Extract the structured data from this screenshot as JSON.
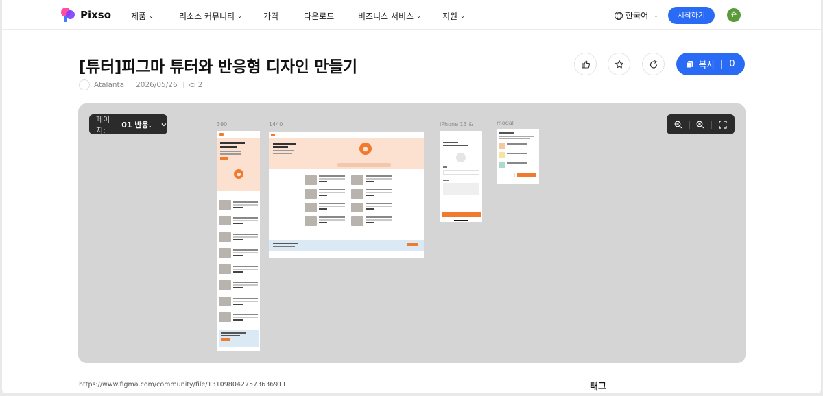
{
  "header": {
    "brand": "Pixso",
    "nav": [
      {
        "label": "제품",
        "has_caret": true
      },
      {
        "label": "리소스 커뮤니티",
        "has_caret": true
      },
      {
        "label": "가격",
        "has_caret": false
      },
      {
        "label": "다운로드",
        "has_caret": false
      },
      {
        "label": "비즈니스 서비스",
        "has_caret": true
      },
      {
        "label": "지원",
        "has_caret": true
      }
    ],
    "caret_glyph": "⌄",
    "language": "한국어",
    "start_label": "시작하기",
    "avatar_initial": "슈",
    "accent": "#2a6bf5"
  },
  "file": {
    "title": "[튜터]피그마 튜터와 반응형 디자인 만들기",
    "author": "Atalanta",
    "date": "2026/05/26",
    "views": "2",
    "copy_label": "복사",
    "copy_count": "0"
  },
  "actions": {
    "icons": [
      "like-icon",
      "favorite-icon",
      "share-icon",
      "copy-icon"
    ]
  },
  "canvas": {
    "page_label": "페이지:",
    "page_value": "01 반응...",
    "frames": [
      {
        "label": "390"
      },
      {
        "label": "1440"
      },
      {
        "label": "iPhone 13 & 1..."
      },
      {
        "label": "modal"
      }
    ],
    "zoom_icons": [
      "zoom-out-icon",
      "zoom-in-icon",
      "fullscreen-icon"
    ]
  },
  "footer": {
    "url": "https://www.figma.com/community/file/1310980427573636911",
    "tag_heading": "태그"
  }
}
